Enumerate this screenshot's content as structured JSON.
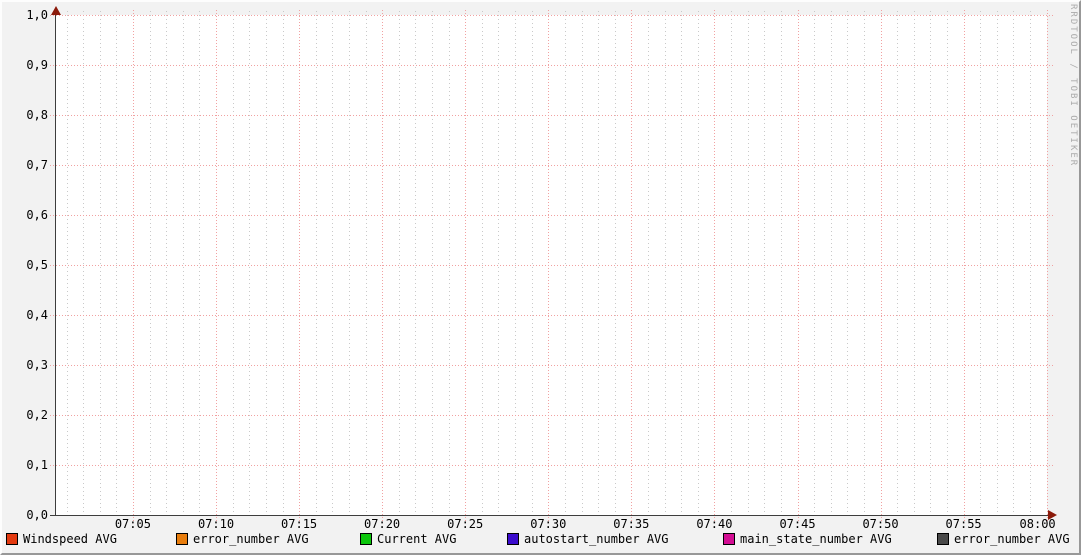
{
  "watermark": "RRDTOOL / TOBI OETIKER",
  "colors": {
    "background": "#F2F2F2",
    "plot_background": "#FFFFFF",
    "major_grid": "#F1A1A1",
    "minor_grid": "#C9C9C9",
    "axis": "#3D3D3D",
    "arrow": "#8B1A0A",
    "text": "#000000",
    "watermark": "#ABABAB"
  },
  "chart_data": {
    "type": "line",
    "title": "",
    "xlabel": "",
    "ylabel": "",
    "x_tick_labels": [
      "07:05",
      "07:10",
      "07:15",
      "07:20",
      "07:25",
      "07:30",
      "07:35",
      "07:40",
      "07:45",
      "07:50",
      "07:55",
      "08:00"
    ],
    "x_minor_ticks_per_major": 5,
    "y_tick_labels": [
      "1,0",
      "0,9",
      "0,8",
      "0,7",
      "0,6",
      "0,5",
      "0,4",
      "0,3",
      "0,2",
      "0,1",
      "0,0"
    ],
    "ylim": [
      0.0,
      1.0
    ],
    "y_major_step": 0.1,
    "grid": true,
    "legend_position": "bottom",
    "series": [
      {
        "name": "Windspeed AVG",
        "color": "#E33A10",
        "values": []
      },
      {
        "name": "error_number AVG",
        "color": "#E87D0D",
        "values": []
      },
      {
        "name": "Current AVG",
        "color": "#0CC60C",
        "values": []
      },
      {
        "name": "autostart_number AVG",
        "color": "#3B0CCD",
        "values": []
      },
      {
        "name": "main_state_number AVG",
        "color": "#D30D93",
        "values": []
      },
      {
        "name": "error_number AVG",
        "color": "#4A4A4A",
        "values": []
      }
    ]
  }
}
